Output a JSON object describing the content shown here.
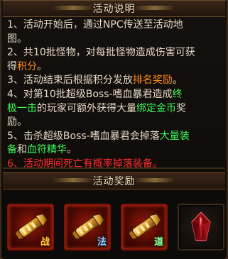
{
  "header_desc": "活动说明",
  "header_rewards": "活动奖励",
  "description": [
    [
      {
        "t": "1、活动开始后，通过NPC传送至活动地",
        "c": ""
      }
    ],
    [
      {
        "t": "图。",
        "c": ""
      }
    ],
    [
      {
        "t": "2、共10批怪物，对每批怪物造成伤害可获",
        "c": ""
      }
    ],
    [
      {
        "t": "得",
        "c": ""
      },
      {
        "t": "积分",
        "c": "hl-orange"
      },
      {
        "t": "。",
        "c": ""
      }
    ],
    [
      {
        "t": "3、活动结束后根据积分发放",
        "c": ""
      },
      {
        "t": "排名奖励",
        "c": "hl-orange"
      },
      {
        "t": "。",
        "c": ""
      }
    ],
    [
      {
        "t": "4、对第10批超级Boss-嗜血暴君造成",
        "c": ""
      },
      {
        "t": "终",
        "c": "hl-green"
      }
    ],
    [
      {
        "t": "极一击",
        "c": "hl-green"
      },
      {
        "t": "的玩家可额外获得大量",
        "c": ""
      },
      {
        "t": "绑定金币",
        "c": "hl-green"
      },
      {
        "t": "奖",
        "c": ""
      }
    ],
    [
      {
        "t": "励。",
        "c": ""
      }
    ],
    [
      {
        "t": "5、击杀超级Boss-嗜血暴君会掉落",
        "c": ""
      },
      {
        "t": "大量装",
        "c": "hl-green"
      }
    ],
    [
      {
        "t": "备",
        "c": "hl-green"
      },
      {
        "t": "和",
        "c": ""
      },
      {
        "t": "血符精华",
        "c": "hl-green"
      },
      {
        "t": "。",
        "c": ""
      }
    ],
    [
      {
        "t": "6、活动期间死亡有概率掉落装备。",
        "c": "hl-red"
      }
    ]
  ],
  "rewards": [
    {
      "icon": "gauntlet-icon",
      "tag": "战",
      "tag_class": "zhan",
      "style": "red"
    },
    {
      "icon": "gauntlet-icon",
      "tag": "法",
      "tag_class": "fa",
      "style": "red"
    },
    {
      "icon": "gauntlet-icon",
      "tag": "道",
      "tag_class": "dao",
      "style": "red"
    },
    {
      "icon": "red-crystal-icon",
      "tag": "",
      "tag_class": "",
      "style": "plain"
    }
  ]
}
